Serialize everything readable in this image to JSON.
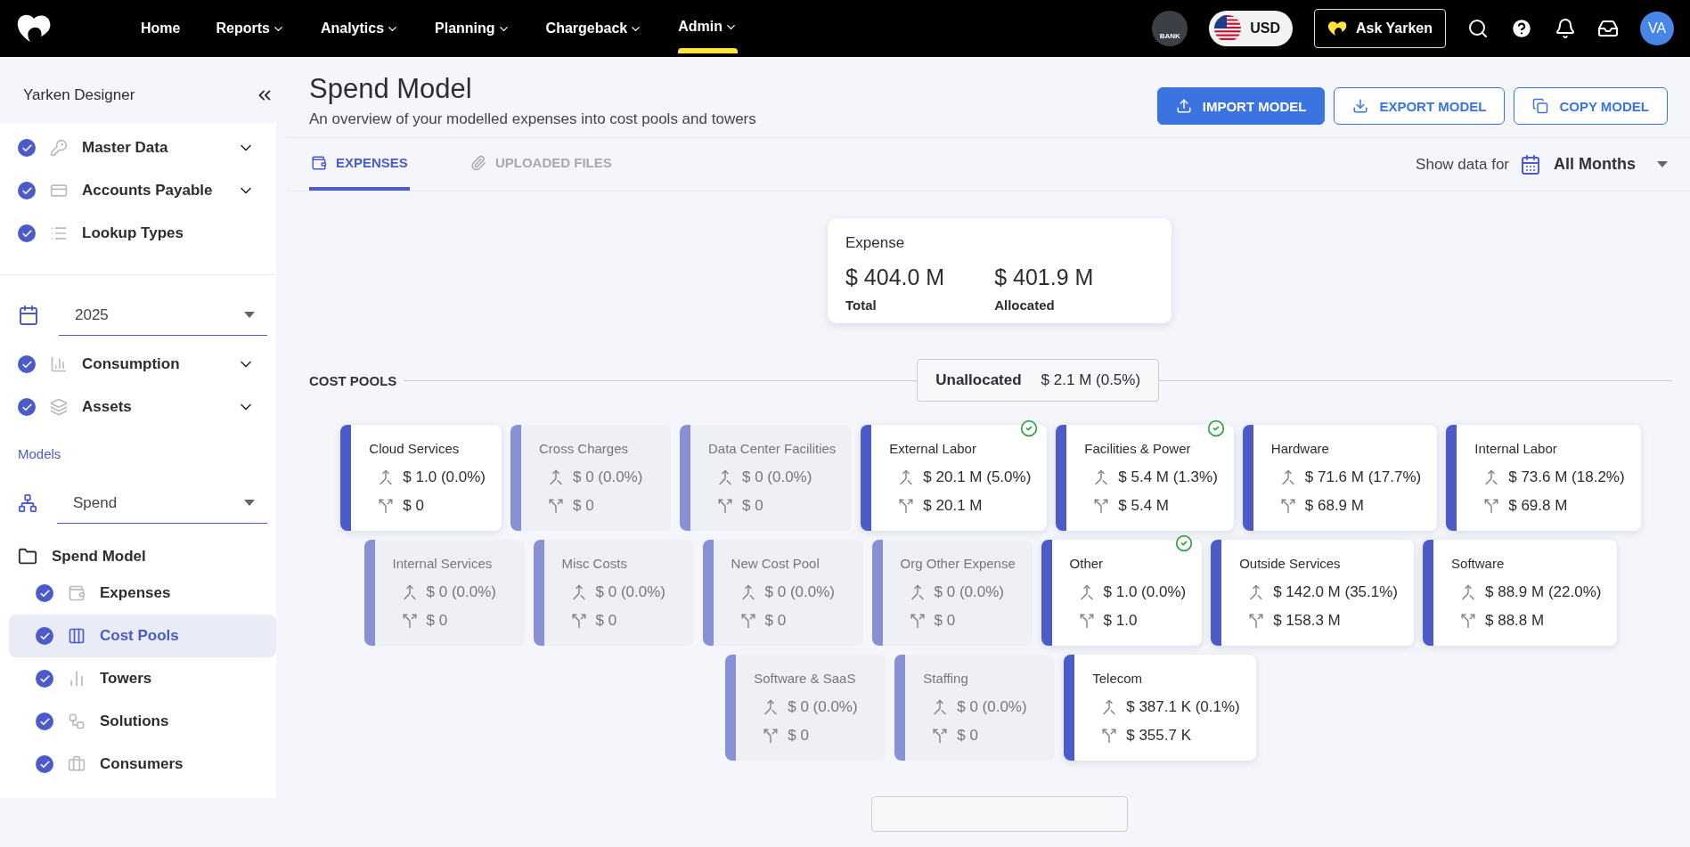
{
  "nav": {
    "items": [
      {
        "label": "Home",
        "dropdown": false,
        "selected": false
      },
      {
        "label": "Reports",
        "dropdown": true,
        "selected": false
      },
      {
        "label": "Analytics",
        "dropdown": true,
        "selected": false
      },
      {
        "label": "Planning",
        "dropdown": true,
        "selected": false
      },
      {
        "label": "Chargeback",
        "dropdown": true,
        "selected": false
      },
      {
        "label": "Admin",
        "dropdown": true,
        "selected": true
      }
    ],
    "bank": "BANK",
    "currency": "USD",
    "ask": "Ask Yarken",
    "avatar": "VA"
  },
  "sidebar": {
    "title": "Yarken Designer",
    "top_items": [
      {
        "label": "Master Data",
        "checked": true,
        "expandable": true
      },
      {
        "label": "Accounts Payable",
        "checked": true,
        "expandable": true
      },
      {
        "label": "Lookup Types",
        "checked": true,
        "expandable": false
      }
    ],
    "year": "2025",
    "mid_items": [
      {
        "label": "Consumption",
        "checked": true,
        "expandable": true
      },
      {
        "label": "Assets",
        "checked": true,
        "expandable": true
      }
    ],
    "models_label": "Models",
    "model": "Spend",
    "folder": "Spend Model",
    "model_items": [
      {
        "label": "Expenses",
        "checked": true,
        "selected": false
      },
      {
        "label": "Cost Pools",
        "checked": true,
        "selected": true
      },
      {
        "label": "Towers",
        "checked": true,
        "selected": false
      },
      {
        "label": "Solutions",
        "checked": true,
        "selected": false
      },
      {
        "label": "Consumers",
        "checked": true,
        "selected": false
      }
    ]
  },
  "page": {
    "title": "Spend Model",
    "subtitle": "An overview of your modelled expenses into cost pools and towers",
    "buttons": [
      {
        "label": "IMPORT MODEL",
        "kind": "primary"
      },
      {
        "label": "EXPORT MODEL",
        "kind": "outline"
      },
      {
        "label": "COPY MODEL",
        "kind": "outline"
      }
    ],
    "tabs": [
      {
        "label": "EXPENSES",
        "selected": true
      },
      {
        "label": "UPLOADED FILES",
        "selected": false
      }
    ],
    "filter_label": "Show data for",
    "filter_value": "All Months"
  },
  "expense": {
    "title": "Expense",
    "total": "$ 404.0 M",
    "total_label": "Total",
    "allocated": "$ 401.9 M",
    "allocated_label": "Allocated"
  },
  "cost_pools": {
    "label": "COST POOLS",
    "unallocated_label": "Unallocated",
    "unallocated_value": "$ 2.1 M (0.5%)",
    "cards": [
      {
        "name": "Cloud Services",
        "active": true,
        "checked": false,
        "incoming": "$ 1.0 (0.0%)",
        "outgoing": "$ 0"
      },
      {
        "name": "Cross Charges",
        "active": false,
        "checked": false,
        "incoming": "$ 0 (0.0%)",
        "outgoing": "$ 0"
      },
      {
        "name": "Data Center Facilities",
        "active": false,
        "checked": false,
        "incoming": "$ 0 (0.0%)",
        "outgoing": "$ 0"
      },
      {
        "name": "External Labor",
        "active": true,
        "checked": true,
        "incoming": "$ 20.1 M (5.0%)",
        "outgoing": "$ 20.1 M"
      },
      {
        "name": "Facilities & Power",
        "active": true,
        "checked": true,
        "incoming": "$ 5.4 M (1.3%)",
        "outgoing": "$ 5.4 M"
      },
      {
        "name": "Hardware",
        "active": true,
        "checked": false,
        "incoming": "$ 71.6 M (17.7%)",
        "outgoing": "$ 68.9 M"
      },
      {
        "name": "Internal Labor",
        "active": true,
        "checked": false,
        "incoming": "$ 73.6 M (18.2%)",
        "outgoing": "$ 69.8 M"
      },
      {
        "name": "Internal Services",
        "active": false,
        "checked": false,
        "incoming": "$ 0 (0.0%)",
        "outgoing": "$ 0"
      },
      {
        "name": "Misc Costs",
        "active": false,
        "checked": false,
        "incoming": "$ 0 (0.0%)",
        "outgoing": "$ 0"
      },
      {
        "name": "New Cost Pool",
        "active": false,
        "checked": false,
        "incoming": "$ 0 (0.0%)",
        "outgoing": "$ 0"
      },
      {
        "name": "Org Other Expense",
        "active": false,
        "checked": false,
        "incoming": "$ 0 (0.0%)",
        "outgoing": "$ 0"
      },
      {
        "name": "Other",
        "active": true,
        "checked": true,
        "incoming": "$ 1.0 (0.0%)",
        "outgoing": "$ 1.0"
      },
      {
        "name": "Outside Services",
        "active": true,
        "checked": false,
        "incoming": "$ 142.0 M (35.1%)",
        "outgoing": "$ 158.3 M"
      },
      {
        "name": "Software",
        "active": true,
        "checked": false,
        "incoming": "$ 88.9 M (22.0%)",
        "outgoing": "$ 88.8 M"
      },
      {
        "name": "Software & SaaS",
        "active": false,
        "checked": false,
        "incoming": "$ 0 (0.0%)",
        "outgoing": "$ 0"
      },
      {
        "name": "Staffing",
        "active": false,
        "checked": false,
        "incoming": "$ 0 (0.0%)",
        "outgoing": "$ 0"
      },
      {
        "name": "Telecom",
        "active": true,
        "checked": false,
        "incoming": "$ 387.1 K (0.1%)",
        "outgoing": "$ 355.7 K"
      }
    ]
  }
}
